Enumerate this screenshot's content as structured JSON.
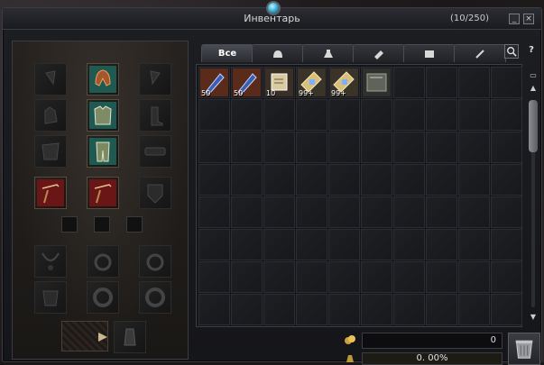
{
  "window": {
    "title": "Инвентарь",
    "count": "(10/250)",
    "minimize_label": "_",
    "close_label": "×"
  },
  "tabs": [
    {
      "label": "Все",
      "icon": "all-text",
      "active": true
    },
    {
      "label": "",
      "icon": "helmet-icon"
    },
    {
      "label": "",
      "icon": "potion-icon"
    },
    {
      "label": "",
      "icon": "material-icon"
    },
    {
      "label": "",
      "icon": "scroll-icon"
    },
    {
      "label": "",
      "icon": "quest-icon"
    }
  ],
  "toolbar": {
    "search_icon": "search-icon",
    "help_label": "?"
  },
  "items": [
    {
      "name": "blue-soulshot",
      "qty": "50",
      "color": "#3a5aa8"
    },
    {
      "name": "blue-spiritshot",
      "qty": "50",
      "color": "#3a5aa8"
    },
    {
      "name": "scroll",
      "qty": "10",
      "color": "#c8b990"
    },
    {
      "name": "elixir",
      "qty": "99+",
      "color": "#bfa56a"
    },
    {
      "name": "elixir-2",
      "qty": "99+",
      "color": "#bfa56a"
    },
    {
      "name": "book",
      "qty": "",
      "color": "#6c7066"
    }
  ],
  "bottom": {
    "adena_value": "0",
    "weight_text": "0. 00%",
    "weight_fraction": 0.0
  }
}
